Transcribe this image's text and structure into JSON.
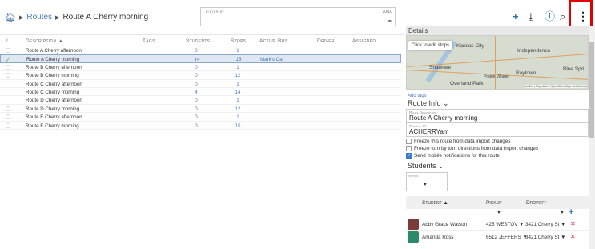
{
  "breadcrumb": {
    "root": "Routes",
    "current": "Route A Cherry morning"
  },
  "filter": {
    "label": "Filter by",
    "count": "10/10"
  },
  "toolbar": {
    "add": "+",
    "download": "⤓",
    "info": "ⓘ",
    "search": "⌕",
    "more": "⋮"
  },
  "grid": {
    "headers": {
      "description": "Description ▲",
      "tags": "Tags",
      "students": "Students",
      "stops": "Stops",
      "active_bus": "Active Bus",
      "driver": "Driver",
      "assigned": "Assigned"
    },
    "rows": [
      {
        "description": "Route A Cherry afternoon",
        "students": "0",
        "stops": "1",
        "bus": ""
      },
      {
        "description": "Route A Cherry morning",
        "students": "14",
        "stops": "15",
        "bus": "Mark's Car"
      },
      {
        "description": "Route B Cherry afternoon",
        "students": "0",
        "stops": "1",
        "bus": ""
      },
      {
        "description": "Route B Cherry morning",
        "students": "0",
        "stops": "12",
        "bus": ""
      },
      {
        "description": "Route C Cherry afternoon",
        "students": "0",
        "stops": "1",
        "bus": ""
      },
      {
        "description": "Route C Cherry morning",
        "students": "4",
        "stops": "14",
        "bus": ""
      },
      {
        "description": "Route D Cherry afternoon",
        "students": "0",
        "stops": "1",
        "bus": ""
      },
      {
        "description": "Route D Cherry morning",
        "students": "0",
        "stops": "12",
        "bus": ""
      },
      {
        "description": "Route E Cherry afternoon",
        "students": "0",
        "stops": "1",
        "bus": ""
      },
      {
        "description": "Route E Cherry morning",
        "students": "0",
        "stops": "15",
        "bus": ""
      }
    ]
  },
  "details": {
    "title": "Details",
    "map": {
      "edit": "Click to edit stops",
      "cities": [
        "Kansas City",
        "Independence",
        "Shawnee",
        "Raytown",
        "Blue Spri",
        "Overland Park",
        "Prairie Village"
      ],
      "attribution": "Leaflet | Map data © OpenStreetMap contributors"
    },
    "add_tags": "Add tags",
    "route_info": "Route Info ⌄",
    "route_description_label": "Route Description",
    "route_description": "Route A Cherry morning",
    "original_id_label": "Original ID",
    "original_id": "ACHERRYam",
    "checks": [
      {
        "label": "Freeze this route from data import changes",
        "checked": false
      },
      {
        "label": "Freeze turn by turn directions from data import changes",
        "checked": false
      },
      {
        "label": "Send mobile notifications for this route",
        "checked": true
      }
    ],
    "students_title": "Students ⌄",
    "action_label": "Action",
    "student_headers": {
      "student": "Student ▲",
      "pickup": "Pickup",
      "dropoff": "Dropoff"
    },
    "students": [
      {
        "name": "Abby Grace Watson",
        "pickup": "425 WESTOV ▼",
        "dropoff": "3421 Cherry St ▼"
      },
      {
        "name": "Amanda Ross",
        "pickup": "6512 JEFFERS ▼",
        "dropoff": "3421 Cherry St ▼"
      }
    ]
  }
}
